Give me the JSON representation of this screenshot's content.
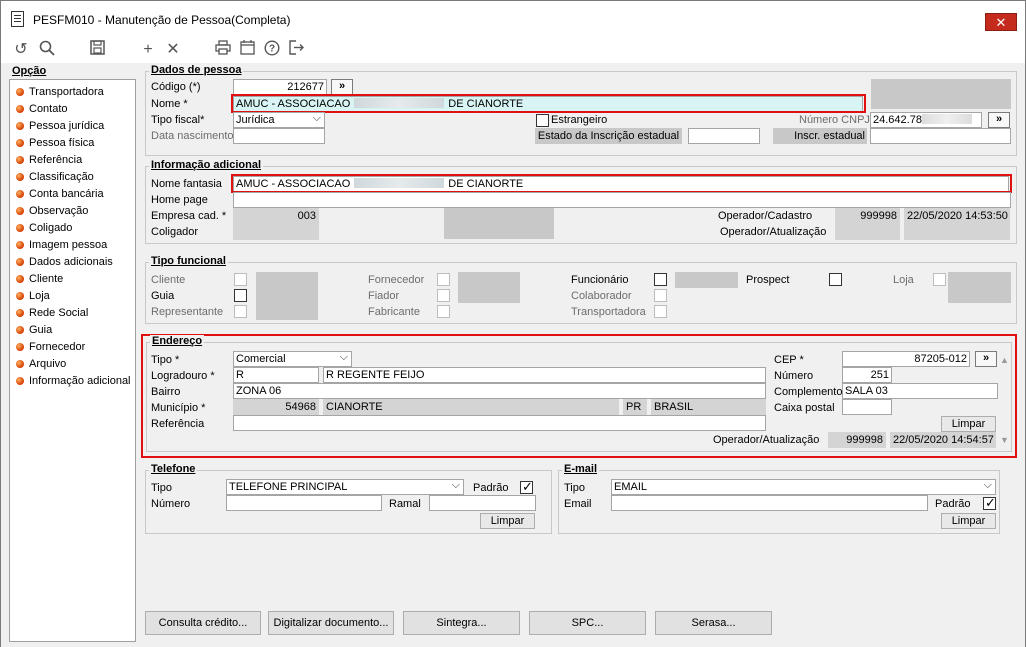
{
  "window": {
    "title": "PESFM010 - Manutenção de Pessoa(Completa)",
    "close_label": "✕"
  },
  "toolbar": {
    "icons": [
      "undo-icon",
      "search-icon",
      "save-icon",
      "add-icon",
      "delete-icon",
      "print-icon",
      "calendar-icon",
      "help-icon",
      "exit-icon"
    ]
  },
  "sidebar": {
    "title": "Opção",
    "items": [
      "Transportadora",
      "Contato",
      "Pessoa jurídica",
      "Pessoa física",
      "Referência",
      "Classificação",
      "Conta bancária",
      "Observação",
      "Coligado",
      "Imagem pessoa",
      "Dados adicionais",
      "Cliente",
      "Loja",
      "Rede Social",
      "Guia",
      "Fornecedor",
      "Arquivo",
      "Informação adicional"
    ]
  },
  "dados": {
    "title": "Dados de pessoa",
    "codigo_label": "Código (*)",
    "codigo": "212677",
    "codigo_btn": "»",
    "nome_label": "Nome *",
    "nome_prefix": "AMUC - ASSOCIACAO",
    "nome_suffix": "DE CIANORTE",
    "tipo_fiscal_label": "Tipo fiscal*",
    "tipo_fiscal": "Jurídica",
    "data_nasc_label": "Data nascimento",
    "estrangeiro_label": "Estrangeiro",
    "estado_ie_label": "Estado da Inscrição estadual",
    "cnpj_label": "Número CNPJ",
    "cnpj": "24.642.78",
    "cnpj_btn": "»",
    "inscr_label": "Inscr. estadual"
  },
  "info": {
    "title": "Informação adicional",
    "fantasia_label": "Nome fantasia",
    "fantasia_prefix": "AMUC - ASSOCIACAO",
    "fantasia_suffix": "DE CIANORTE",
    "homepage_label": "Home page",
    "empresa_label": "Empresa cad. *",
    "empresa": "003",
    "coligador_label": "Coligador",
    "op_cad_label": "Operador/Cadastro",
    "op_cad": "999998",
    "op_cad_date": "22/05/2020 14:53:50",
    "op_atu_label": "Operador/Atualização"
  },
  "tipo": {
    "title": "Tipo funcional",
    "cliente": "Cliente",
    "guia": "Guia",
    "representante": "Representante",
    "fornecedor": "Fornecedor",
    "fiador": "Fiador",
    "fabricante": "Fabricante",
    "funcionario": "Funcionário",
    "colaborador": "Colaborador",
    "transportadora": "Transportadora",
    "prospect": "Prospect",
    "loja": "Loja"
  },
  "endereco": {
    "title": "Endereço",
    "tipo_label": "Tipo *",
    "tipo": "Comercial",
    "logradouro_label": "Logradouro *",
    "logradouro_tipo": "R",
    "logradouro": "R REGENTE FEIJO",
    "bairro_label": "Bairro",
    "bairro": "ZONA 06",
    "municipio_label": "Município *",
    "municipio_cod": "54968",
    "municipio": "CIANORTE",
    "uf": "PR",
    "pais": "BRASIL",
    "referencia_label": "Referência",
    "cep_label": "CEP *",
    "cep": "87205-012",
    "cep_btn": "»",
    "numero_label": "Número",
    "numero": "251",
    "complemento_label": "Complemento",
    "complemento": "SALA 03",
    "caixa_label": "Caixa postal",
    "limpar": "Limpar",
    "op_atu_label": "Operador/Atualização",
    "op_atu": "999998",
    "op_atu_date": "22/05/2020 14:54:57"
  },
  "telefone": {
    "title": "Telefone",
    "tipo_label": "Tipo",
    "tipo": "TELEFONE PRINCIPAL",
    "padrao_label": "Padrão",
    "numero_label": "Número",
    "ramal_label": "Ramal",
    "limpar": "Limpar"
  },
  "email": {
    "title": "E-mail",
    "tipo_label": "Tipo",
    "tipo": "EMAIL",
    "email_label": "Email",
    "padrao_label": "Padrão",
    "limpar": "Limpar"
  },
  "bottom": {
    "consulta": "Consulta crédito...",
    "digitalizar": "Digitalizar documento...",
    "sintegra": "Sintegra...",
    "spc": "SPC...",
    "serasa": "Serasa..."
  }
}
